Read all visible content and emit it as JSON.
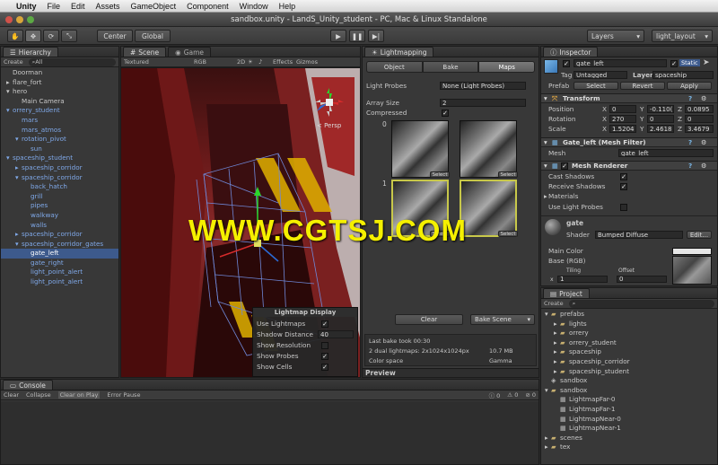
{
  "menubar": {
    "apple": "",
    "items": [
      "Unity",
      "File",
      "Edit",
      "Assets",
      "GameObject",
      "Component",
      "Window",
      "Help"
    ]
  },
  "window_title": "sandbox.unity - LandS_Unity_student - PC, Mac & Linux Standalone",
  "toolbar": {
    "center": "Center",
    "global": "Global",
    "layers": "Layers",
    "layout": "light_layout"
  },
  "hierarchy": {
    "tab": "Hierarchy",
    "create": "Create",
    "search": "All",
    "items": [
      {
        "t": "Doorman",
        "i": 0,
        "b": false
      },
      {
        "t": "flare_fort",
        "i": 0,
        "b": false,
        "a": "▸"
      },
      {
        "t": "hero",
        "i": 0,
        "b": false,
        "a": "▾"
      },
      {
        "t": "Main Camera",
        "i": 1,
        "b": false
      },
      {
        "t": "orrery_student",
        "i": 0,
        "b": true,
        "a": "▾"
      },
      {
        "t": "mars",
        "i": 1,
        "b": true
      },
      {
        "t": "mars_atmos",
        "i": 1,
        "b": true
      },
      {
        "t": "rotation_pivot",
        "i": 1,
        "b": true,
        "a": "▾"
      },
      {
        "t": "sun",
        "i": 2,
        "b": true
      },
      {
        "t": "spaceship_student",
        "i": 0,
        "b": true,
        "a": "▾"
      },
      {
        "t": "spaceship_corridor",
        "i": 1,
        "b": true,
        "a": "▸"
      },
      {
        "t": "spaceship_corridor",
        "i": 1,
        "b": true,
        "a": "▾"
      },
      {
        "t": "back_hatch",
        "i": 2,
        "b": true
      },
      {
        "t": "grill",
        "i": 2,
        "b": true
      },
      {
        "t": "pipes",
        "i": 2,
        "b": true
      },
      {
        "t": "walkway",
        "i": 2,
        "b": true
      },
      {
        "t": "walls",
        "i": 2,
        "b": true
      },
      {
        "t": "spaceship_corridor",
        "i": 1,
        "b": true,
        "a": "▸"
      },
      {
        "t": "spaceship_corridor_gates",
        "i": 1,
        "b": true,
        "a": "▾"
      },
      {
        "t": "gate_left",
        "i": 2,
        "b": false,
        "s": true
      },
      {
        "t": "gate_right",
        "i": 2,
        "b": true
      },
      {
        "t": "light_point_alert",
        "i": 2,
        "b": true
      },
      {
        "t": "light_point_alert",
        "i": 2,
        "b": true
      }
    ]
  },
  "scene": {
    "tab_scene": "Scene",
    "tab_game": "Game",
    "textured": "Textured",
    "rgb": "RGB",
    "twod": "2D",
    "effects": "Effects",
    "gizmos": "Gizmos",
    "persp": "< Persp"
  },
  "lightmap_display": {
    "title": "Lightmap Display",
    "use_lightmaps": "Use Lightmaps",
    "shadow_distance": "Shadow Distance",
    "shadow_value": "40",
    "show_resolution": "Show Resolution",
    "show_probes": "Show Probes",
    "show_cells": "Show Cells"
  },
  "lightmapping": {
    "tab": "Lightmapping",
    "tabs": [
      "Object",
      "Bake",
      "Maps"
    ],
    "light_probes": "Light Probes",
    "light_probes_val": "None (Light Probes)",
    "array_size": "Array Size",
    "array_size_val": "2",
    "compressed": "Compressed",
    "idx0": "0",
    "idx1": "1",
    "select": "Select",
    "clear": "Clear",
    "bake_scene": "Bake Scene",
    "last_bake": "Last bake took 00:30",
    "dual": "2 dual lightmaps: 2x1024x1024px",
    "size": "10.7 MB",
    "color_space": "Color space",
    "gamma": "Gamma",
    "preview": "Preview"
  },
  "watermark": "WWW.CGTSJ.COM",
  "inspector": {
    "tab": "Inspector",
    "name": "gate_left",
    "static": "Static",
    "tag": "Tag",
    "tag_val": "Untagged",
    "layer": "Layer",
    "layer_val": "spaceship",
    "prefab": "Prefab",
    "select": "Select",
    "revert": "Revert",
    "apply": "Apply",
    "transform": "Transform",
    "position": "Position",
    "rotation": "Rotation",
    "scale": "Scale",
    "pos": {
      "x": "0",
      "y": "-0.110(",
      "z": "0.0895"
    },
    "rot": {
      "x": "270",
      "y": "0",
      "z": "0"
    },
    "scl": {
      "x": "1.5204",
      "y": "2.4618",
      "z": "3.4679"
    },
    "mesh_filter": "Gate_left (Mesh Filter)",
    "mesh": "Mesh",
    "mesh_val": "gate_left",
    "mesh_renderer": "Mesh Renderer",
    "cast_shadows": "Cast Shadows",
    "receive_shadows": "Receive Shadows",
    "materials": "Materials",
    "use_light_probes": "Use Light Probes",
    "material": "gate",
    "shader": "Shader",
    "shader_val": "Bumped Diffuse",
    "edit": "Edit...",
    "main_color": "Main Color",
    "base": "Base (RGB)",
    "tiling": "Tiling",
    "offset": "Offset",
    "x": "x",
    "tx": "1",
    "ox": "0"
  },
  "project": {
    "tab": "Project",
    "create": "Create",
    "items": [
      {
        "t": "prefabs",
        "i": 0,
        "f": true,
        "a": "▾"
      },
      {
        "t": "lights",
        "i": 1,
        "f": true,
        "a": "▸"
      },
      {
        "t": "orrery",
        "i": 1,
        "f": true,
        "a": "▸"
      },
      {
        "t": "orrery_student",
        "i": 1,
        "f": true,
        "a": "▸"
      },
      {
        "t": "spaceship",
        "i": 1,
        "f": true,
        "a": "▸"
      },
      {
        "t": "spaceship_corridor",
        "i": 1,
        "f": true,
        "a": "▸"
      },
      {
        "t": "spaceship_student",
        "i": 1,
        "f": true,
        "a": "▸"
      },
      {
        "t": "sandbox",
        "i": 0,
        "f": false
      },
      {
        "t": "sandbox",
        "i": 0,
        "f": true,
        "a": "▾"
      },
      {
        "t": "LightmapFar-0",
        "i": 1,
        "f": false
      },
      {
        "t": "LightmapFar-1",
        "i": 1,
        "f": false
      },
      {
        "t": "LightmapNear-0",
        "i": 1,
        "f": false
      },
      {
        "t": "LightmapNear-1",
        "i": 1,
        "f": false
      },
      {
        "t": "scenes",
        "i": 0,
        "f": true,
        "a": "▸"
      },
      {
        "t": "tex",
        "i": 0,
        "f": true,
        "a": "▸"
      }
    ]
  },
  "console": {
    "tab": "Console",
    "clear": "Clear",
    "collapse": "Collapse",
    "clear_on_play": "Clear on Play",
    "error_pause": "Error Pause",
    "c0": "0",
    "c1": "0",
    "c2": "0"
  }
}
